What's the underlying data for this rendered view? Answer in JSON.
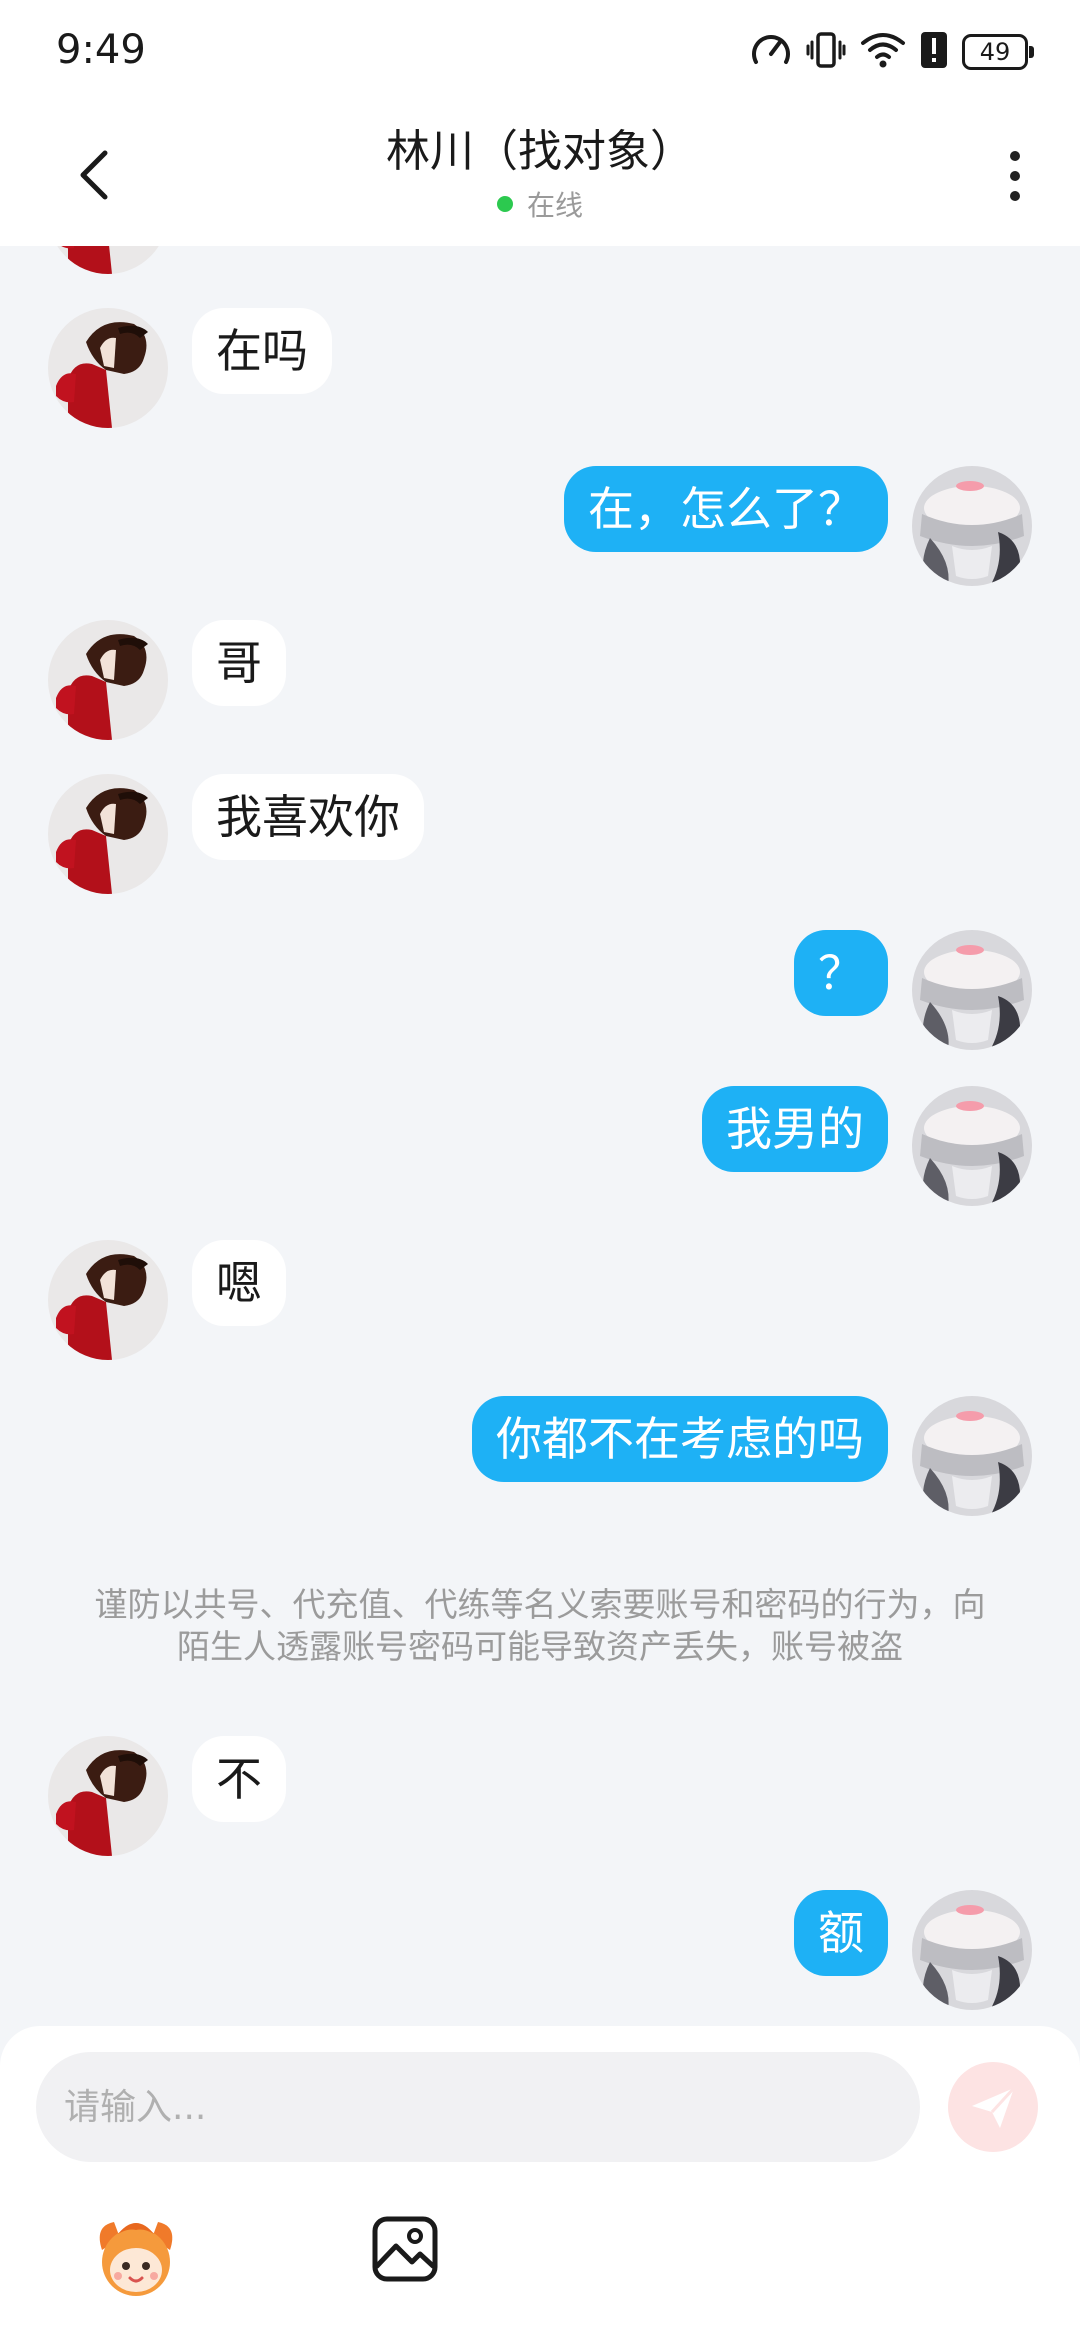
{
  "status_bar": {
    "time": "9:49",
    "battery": "49",
    "icons": [
      "speed-icon",
      "vibrate-icon",
      "wifi-icon",
      "alert-icon",
      "battery-icon"
    ]
  },
  "header": {
    "title": "林川（找对象）",
    "status": "在线",
    "status_color": "#2cc94f",
    "back_icon": "chevron-left-icon",
    "more_icon": "more-vertical-icon"
  },
  "messages": [
    {
      "side": "left",
      "text": "在吗"
    },
    {
      "side": "right",
      "text": "在，怎么了？"
    },
    {
      "side": "left",
      "text": "哥"
    },
    {
      "side": "left",
      "text": "我喜欢你"
    },
    {
      "side": "right",
      "text": "？"
    },
    {
      "side": "right",
      "text": "我男的"
    },
    {
      "side": "left",
      "text": "嗯"
    },
    {
      "side": "right",
      "text": "你都不在考虑的吗"
    },
    {
      "side": "left",
      "text": "不"
    },
    {
      "side": "right",
      "text": "额"
    }
  ],
  "notice": "谨防以共号、代充值、代练等名义索要账号和密码的行为，向陌生人透露账号密码可能导致资产丢失，账号被盗",
  "input": {
    "placeholder": "请输入...",
    "value": ""
  },
  "toolbar": {
    "send_icon": "send-icon",
    "sticker_icon": "sticker-icon",
    "image_icon": "image-icon"
  },
  "colors": {
    "accent": "#1eb1f5",
    "background": "#f3f5f8",
    "send_button": "#fde3e3"
  }
}
